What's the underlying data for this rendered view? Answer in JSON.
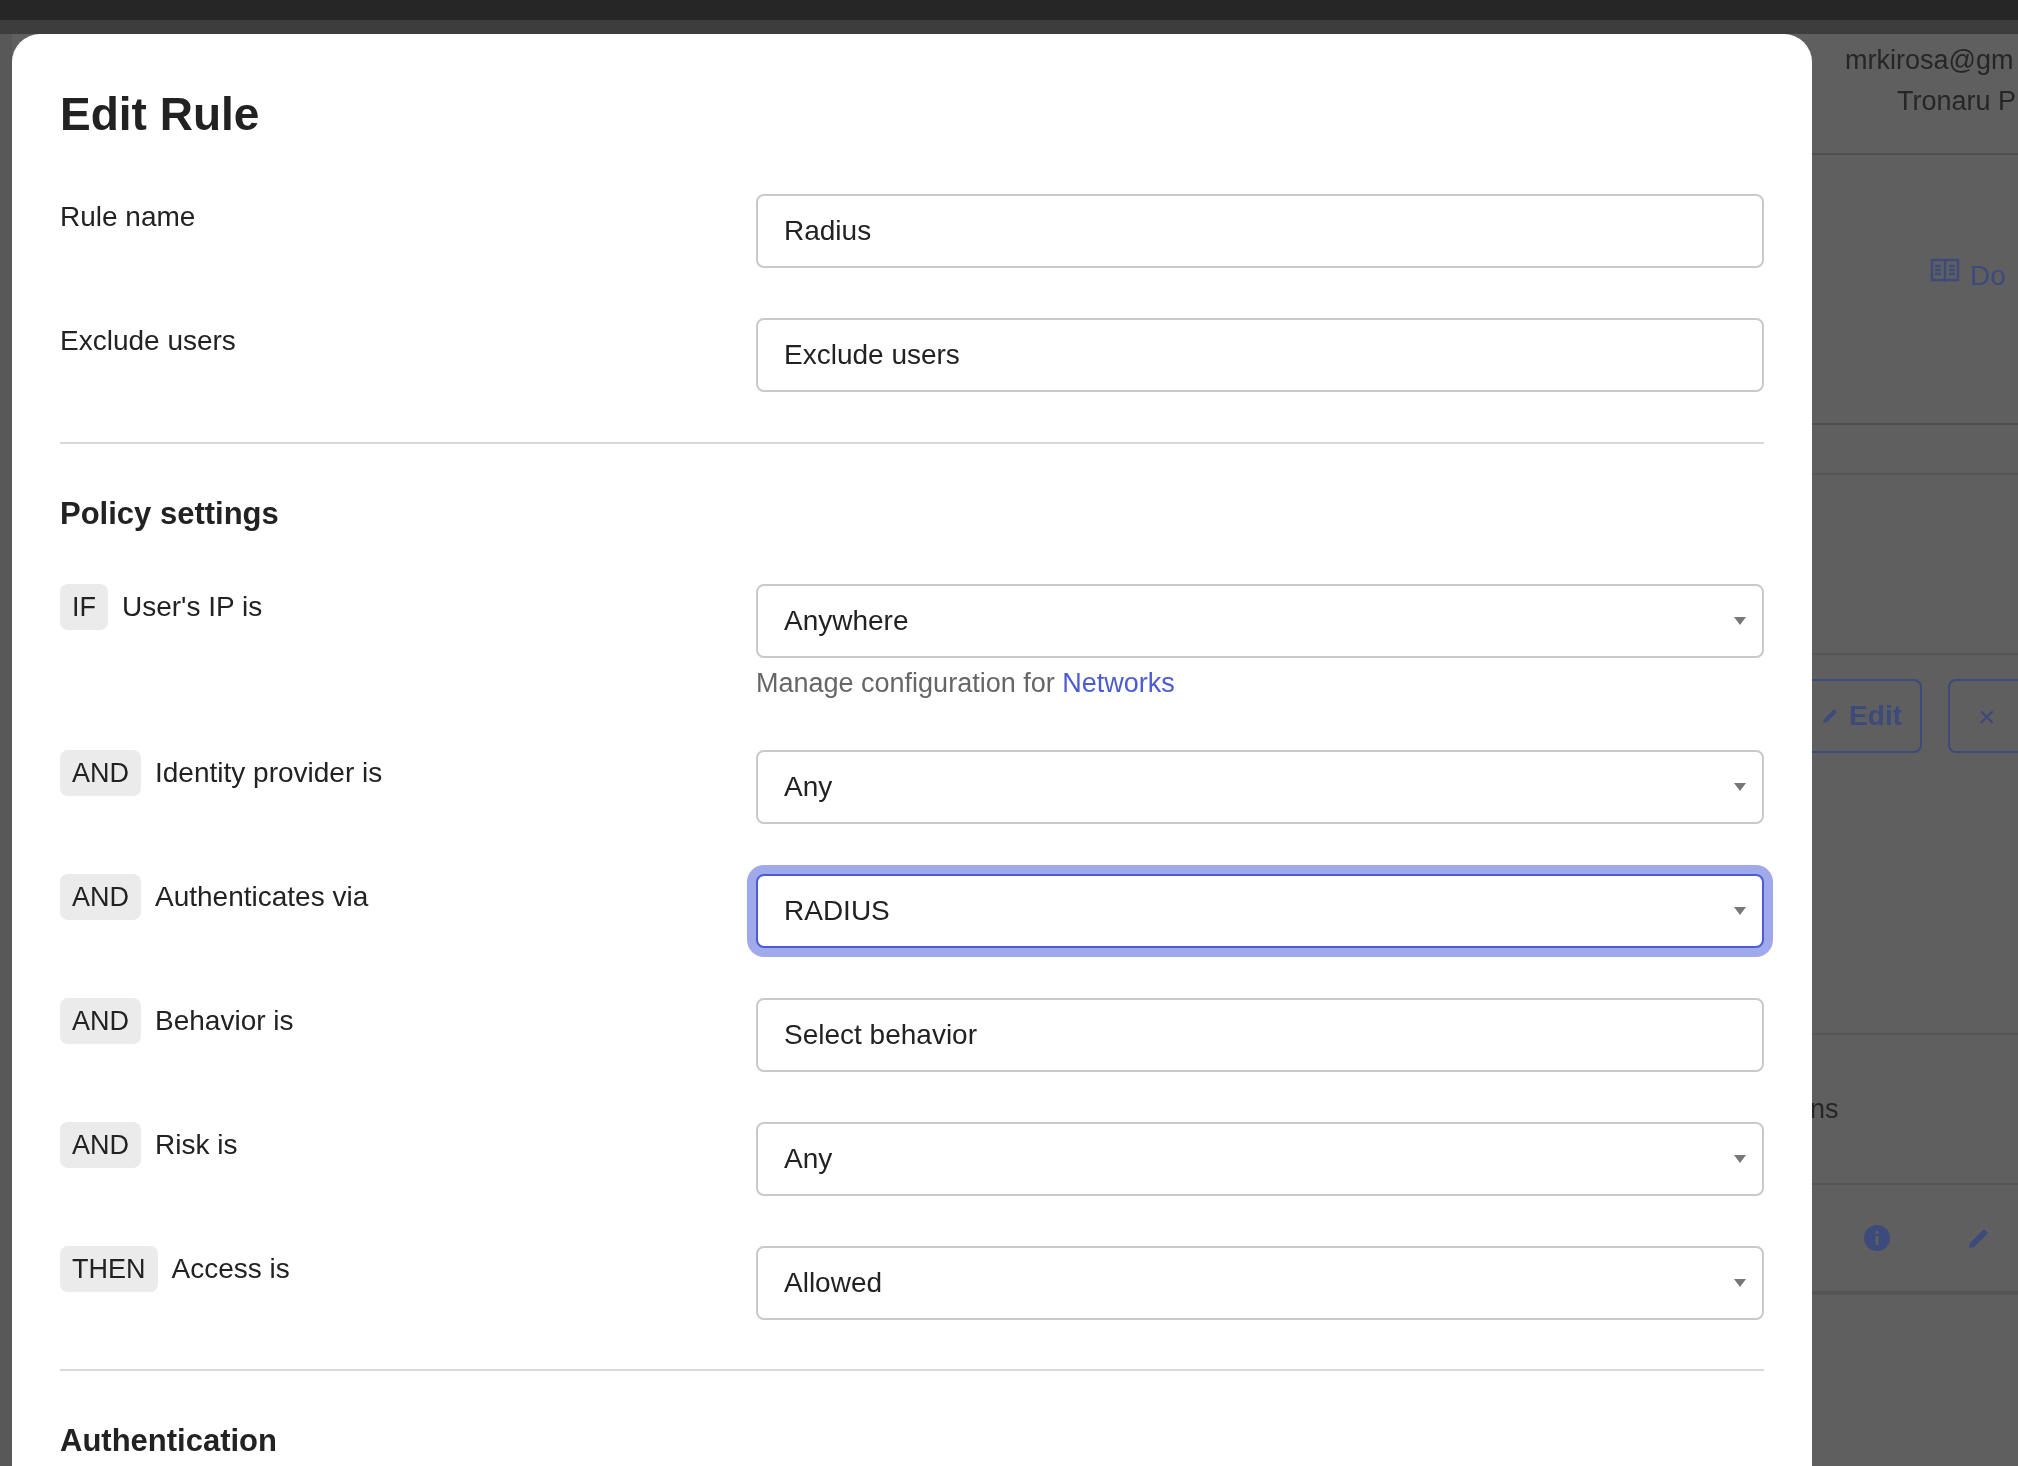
{
  "background_page": {
    "user_email": "mrkirosa@gm",
    "organization": "Tronaru P",
    "docs_link": "Do",
    "edit_button": "Edit",
    "remove_button": "×",
    "column_header": "ns"
  },
  "dialog": {
    "title": "Edit Rule",
    "fields": [
      {
        "label": "Rule name",
        "value": "Radius"
      },
      {
        "label": "Exclude users",
        "placeholder": "Exclude users"
      }
    ],
    "policy_settings": {
      "title": "Policy settings",
      "conditions": [
        {
          "operator": "IF",
          "label": "User's IP is",
          "kind": "select",
          "value": "Anywhere",
          "focused": false,
          "help": {
            "text": "Manage configuration for",
            "link": "Networks"
          }
        },
        {
          "operator": "AND",
          "label": "Identity provider is",
          "kind": "select",
          "value": "Any",
          "focused": false
        },
        {
          "operator": "AND",
          "label": "Authenticates via",
          "kind": "select",
          "value": "RADIUS",
          "focused": true
        },
        {
          "operator": "AND",
          "label": "Behavior is",
          "kind": "input",
          "placeholder": "Select behavior",
          "focused": false
        },
        {
          "operator": "AND",
          "label": "Risk is",
          "kind": "select",
          "value": "Any",
          "focused": false
        },
        {
          "operator": "THEN",
          "label": "Access is",
          "kind": "select",
          "value": "Allowed",
          "focused": false
        }
      ]
    },
    "next_section": {
      "title": "Authentication"
    }
  }
}
